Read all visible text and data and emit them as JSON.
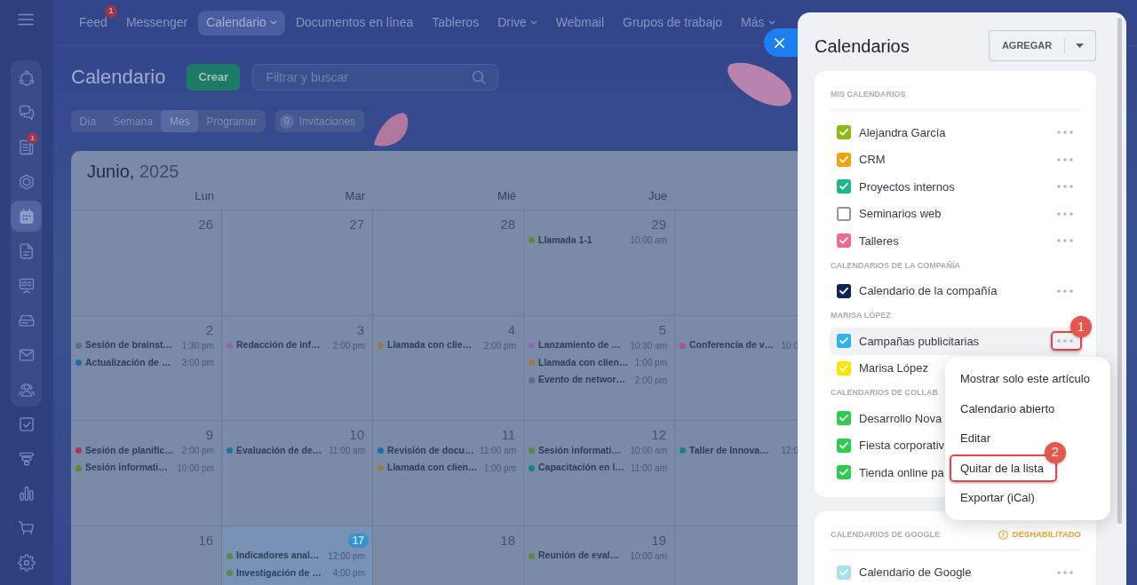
{
  "topbar": {
    "items": [
      {
        "label": "Feed",
        "selected": false,
        "dropdown": false,
        "badge": "1"
      },
      {
        "label": "Messenger",
        "selected": false,
        "dropdown": false
      },
      {
        "label": "Calendario",
        "selected": true,
        "dropdown": true
      },
      {
        "label": "Documentos en línea",
        "selected": false,
        "dropdown": false
      },
      {
        "label": "Tableros",
        "selected": false,
        "dropdown": false
      },
      {
        "label": "Drive",
        "selected": false,
        "dropdown": true
      },
      {
        "label": "Webmail",
        "selected": false,
        "dropdown": false
      },
      {
        "label": "Grupos de trabajo",
        "selected": false,
        "dropdown": false
      },
      {
        "label": "Más",
        "selected": false,
        "dropdown": true
      }
    ]
  },
  "sidebar": {
    "pinned": [
      {
        "kind": "activity",
        "selected": false
      },
      {
        "kind": "chat",
        "selected": false
      },
      {
        "kind": "feed",
        "selected": false,
        "badge": "1"
      },
      {
        "kind": "hexagon",
        "selected": false
      },
      {
        "kind": "calendar",
        "selected": true
      },
      {
        "kind": "document",
        "selected": false
      },
      {
        "kind": "board",
        "selected": false
      },
      {
        "kind": "drive",
        "selected": false
      },
      {
        "kind": "mail",
        "selected": false
      },
      {
        "kind": "people",
        "selected": false
      }
    ],
    "items": [
      {
        "kind": "tasks",
        "selected": false
      },
      {
        "kind": "funnel",
        "selected": false
      },
      {
        "kind": "chart",
        "selected": false
      },
      {
        "kind": "cart",
        "selected": false
      },
      {
        "kind": "settings",
        "selected": false
      }
    ]
  },
  "toolbar": {
    "title": "Calendario",
    "create_button": "Crear",
    "search": {
      "placeholder": "Filtrar y buscar"
    }
  },
  "views": {
    "tabs": [
      {
        "label": "Día",
        "selected": false
      },
      {
        "label": "Semana",
        "selected": false
      },
      {
        "label": "Mes",
        "selected": true
      },
      {
        "label": "Programar",
        "selected": false
      }
    ],
    "invitations": {
      "count": "0",
      "label": "Invitaciones"
    }
  },
  "calendar": {
    "month": "Junio,",
    "year": "2025",
    "weekdays": [
      "Lun",
      "Mar",
      "Mié",
      "Jue"
    ],
    "weeks": [
      {
        "days": [
          {
            "number": "26",
            "today": false
          },
          {
            "number": "27",
            "today": false
          },
          {
            "number": "28",
            "today": false
          },
          {
            "number": "29",
            "today": false,
            "events": [
              {
                "title": "Llamada 1-1",
                "time": "10:00 am",
                "color": "#5b8a3c"
              }
            ]
          },
          {
            "today": false
          }
        ]
      },
      {
        "days": [
          {
            "number": "2",
            "today": false,
            "events": [
              {
                "title": "Sesión de brainst…",
                "time": "1:30 pm",
                "color": "#5b6c8c"
              },
              {
                "title": "Actualización de …",
                "time": "3:00 pm",
                "color": "#1d6fa8"
              }
            ]
          },
          {
            "number": "3",
            "today": false,
            "events": [
              {
                "title": "Redacción de inf…",
                "time": "2:00 pm",
                "color": "#8b6bb3"
              }
            ]
          },
          {
            "number": "4",
            "today": false,
            "events": [
              {
                "title": "Llamada con clie…",
                "time": "2:00 pm",
                "color": "#9b7a45"
              }
            ]
          },
          {
            "number": "5",
            "today": false,
            "events": [
              {
                "title": "Lanzamiento de …",
                "time": "10:30 am",
                "color": "#8b6bb3"
              },
              {
                "title": "Llamada con clien…",
                "time": "1:00 pm",
                "color": "#9b7a45"
              },
              {
                "title": "Evento de networ…",
                "time": "2:00 pm",
                "color": "#5b6c8c"
              }
            ]
          },
          {
            "today": false,
            "events": [
              {
                "title": "Conferencia de v…",
                "time": "10:0",
                "color": "#a55a85"
              }
            ]
          }
        ]
      },
      {
        "days": [
          {
            "number": "9",
            "today": false,
            "events": [
              {
                "title": "Sesión de planific…",
                "time": "2:00 pm",
                "color": "#a2384c"
              },
              {
                "title": "Sesión informati…",
                "time": "10:00 pm",
                "color": "#5b8a3c"
              }
            ]
          },
          {
            "number": "10",
            "today": false,
            "events": [
              {
                "title": "Evaluación de de…",
                "time": "11:00 am",
                "color": "#1d6fa8"
              }
            ]
          },
          {
            "number": "11",
            "today": false,
            "events": [
              {
                "title": "Revisión de docu…",
                "time": "11:00 am",
                "color": "#1d6fa8"
              },
              {
                "title": "Llamada con clien…",
                "time": "1:00 pm",
                "color": "#9b7a45"
              }
            ]
          },
          {
            "number": "12",
            "today": false,
            "events": [
              {
                "title": "Sesión informati…",
                "time": "10:00 am",
                "color": "#5b8a3c"
              },
              {
                "title": "Capacitación en l…",
                "time": "11:00 am",
                "color": "#188577"
              }
            ]
          },
          {
            "today": false,
            "events": [
              {
                "title": "Taller de Innova…",
                "time": "12:0",
                "color": "#188577"
              }
            ]
          }
        ]
      },
      {
        "days": [
          {
            "number": "16",
            "today": false
          },
          {
            "number": "17",
            "today": true,
            "events": [
              {
                "title": "Indicadores anal…",
                "time": "12:00 pm",
                "color": "#5b8a3c"
              },
              {
                "title": "Investigación de …",
                "time": "4:00 pm",
                "color": "#5b8a3c"
              }
            ]
          },
          {
            "number": "18",
            "today": false
          },
          {
            "number": "19",
            "today": false,
            "events": [
              {
                "title": "Reunión de eval…",
                "time": "10:00 am",
                "color": "#5b8a3c"
              }
            ]
          },
          {
            "today": false
          }
        ]
      }
    ]
  },
  "panel": {
    "title": "Calendarios",
    "add_button": "AGREGAR",
    "cards": [
      {
        "sections": [
          {
            "heading": "MIS CALENDARIOS",
            "items": [
              {
                "label": "Alejandra García",
                "color": "#8bbb12",
                "checked": true,
                "hovered": false,
                "more_button": true
              },
              {
                "label": "CRM",
                "color": "#f2a20c",
                "checked": true,
                "hovered": false,
                "more_button": true
              },
              {
                "label": "Proyectos internos",
                "color": "#20b48a",
                "checked": true,
                "hovered": false,
                "more_button": true
              },
              {
                "label": "Seminarios web",
                "color": "#8d96a6",
                "checked": false,
                "hovered": false,
                "more_button": true
              },
              {
                "label": "Talleres",
                "color": "#ef6a8c",
                "checked": true,
                "hovered": false,
                "more_button": true
              }
            ]
          },
          {
            "heading": "CALENDARIOS DE LA COMPAÑÍA",
            "items": [
              {
                "label": "Calendario de la compañía",
                "color": "#0e2458",
                "checked": true,
                "hovered": false,
                "more_button": true
              }
            ]
          },
          {
            "heading": "MARISA LÓPEZ",
            "items": [
              {
                "label": "Campañas publicitarias",
                "color": "#2fb1ee",
                "checked": true,
                "hovered": true,
                "more_button": true,
                "callout": "1"
              },
              {
                "label": "Marisa López",
                "color": "#f7e600",
                "checked": true,
                "hovered": false,
                "more_button": false
              }
            ]
          },
          {
            "heading": "CALENDARIOS DE COLLAB",
            "items": [
              {
                "label": "Desarrollo Nova",
                "color": "#2ecb4e",
                "checked": true,
                "hovered": false,
                "more_button": false
              },
              {
                "label": "Fiesta corporativ",
                "color": "#2ecb4e",
                "checked": true,
                "hovered": false,
                "more_button": false
              },
              {
                "label": "Tienda online pa",
                "color": "#2ecb4e",
                "checked": true,
                "hovered": false,
                "more_button": false
              }
            ]
          }
        ]
      },
      {
        "sections": [
          {
            "heading": "CALENDARIOS DE GOOGLE",
            "warning": "DESHABILITADO",
            "items": [
              {
                "label": "Calendario de Google",
                "color": "#a6e1ee",
                "checked": true,
                "hovered": false,
                "more_button": true
              }
            ]
          }
        ]
      }
    ],
    "menu": {
      "items": [
        {
          "label": "Mostrar solo este artículo"
        },
        {
          "label": "Calendario abierto"
        },
        {
          "label": "Editar"
        },
        {
          "label": "Quitar de la lista",
          "callout": "2"
        },
        {
          "label": "Exportar (iCal)"
        }
      ]
    }
  }
}
